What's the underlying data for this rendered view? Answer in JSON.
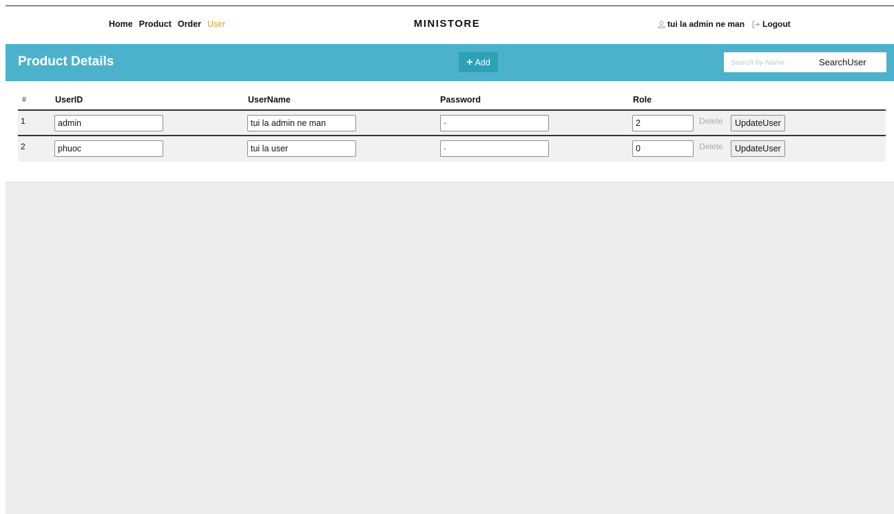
{
  "nav": {
    "links": [
      {
        "label": "Home",
        "active": false
      },
      {
        "label": "Product",
        "active": false
      },
      {
        "label": "Order",
        "active": false
      },
      {
        "label": "User",
        "active": true
      }
    ],
    "brand": "MINISTORE",
    "username": "tui la admin ne man",
    "logout_label": "Logout",
    "user_icon": "user-icon",
    "logout_icon": "logout-icon"
  },
  "header": {
    "title": "Product Details",
    "add_label": "Add",
    "search_placeholder": "Search by Name",
    "search_button": "SearchUser"
  },
  "table": {
    "columns": [
      "#",
      "UserID",
      "UserName",
      "Password",
      "Role"
    ],
    "rows": [
      {
        "index": "1",
        "user_id": "admin",
        "user_name": "tui la admin ne man",
        "password": "·",
        "role": "2"
      },
      {
        "index": "2",
        "user_id": "phuoc",
        "user_name": "tui la user",
        "password": "·",
        "role": "0"
      }
    ],
    "delete_label": "Delete",
    "update_label": "UpdateUser"
  },
  "colors": {
    "header_bar": "#4cb2cc",
    "add_button": "#2fa0b6",
    "active_nav": "#d9a33b",
    "background": "#ececec"
  }
}
